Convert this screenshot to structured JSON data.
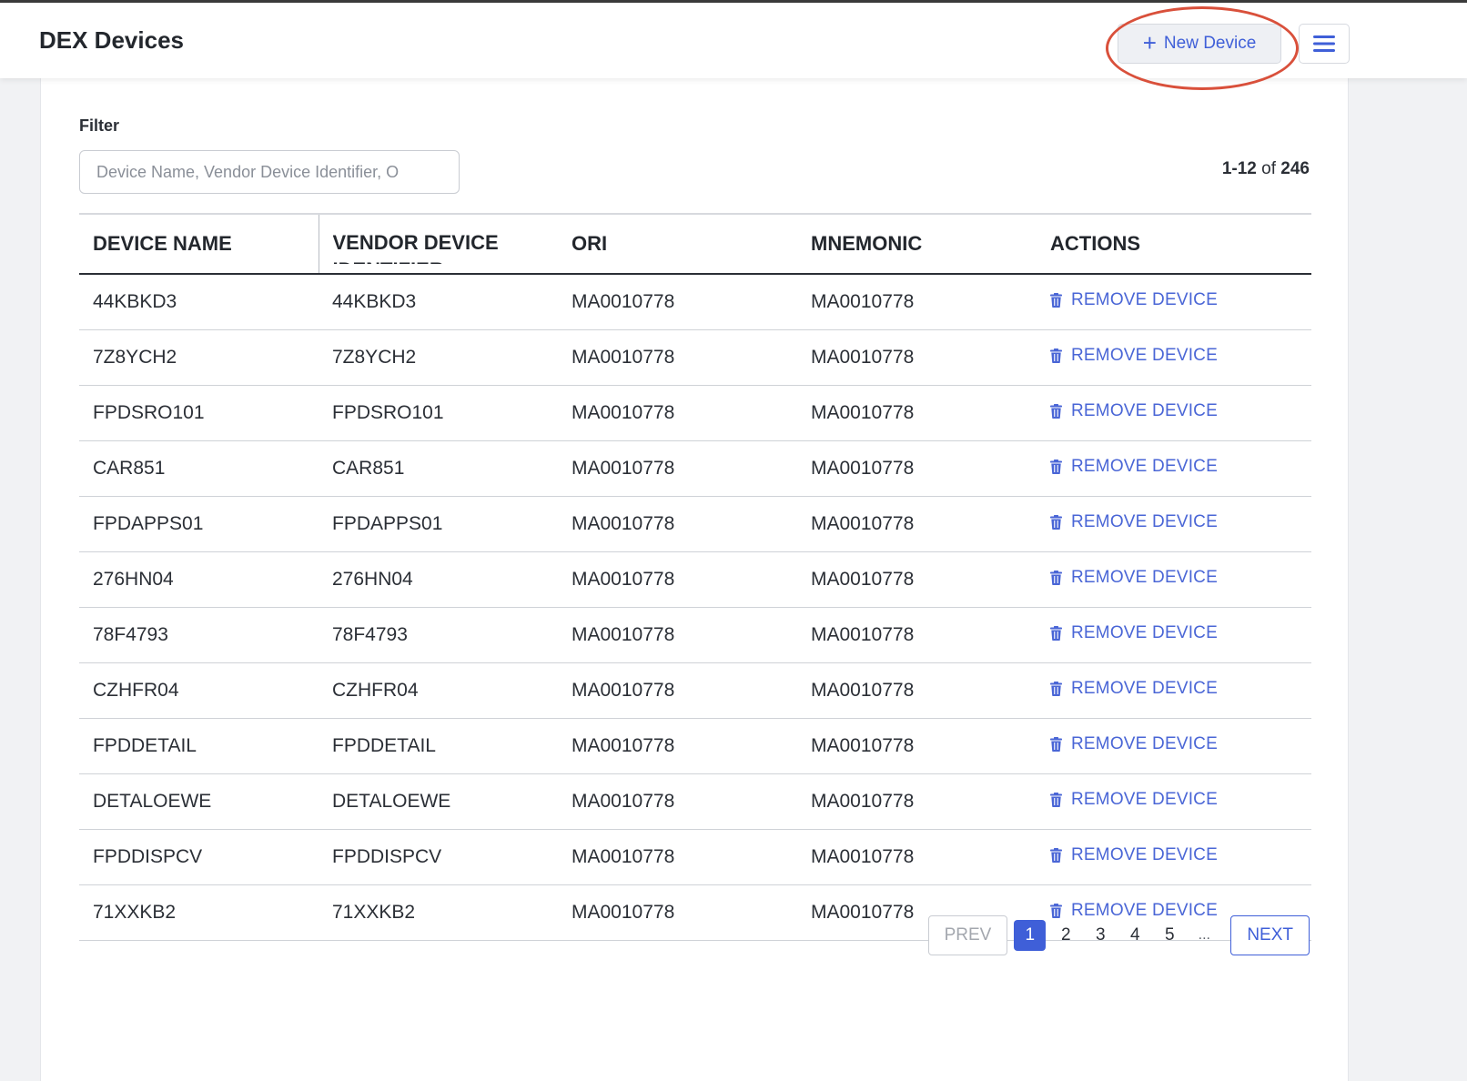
{
  "header": {
    "title": "DEX Devices",
    "new_device_label": "New Device",
    "plus_glyph": "+",
    "menu_icon": "hamburger-menu-icon"
  },
  "filter": {
    "label": "Filter",
    "placeholder": "Device Name, Vendor Device Identifier, O",
    "value": ""
  },
  "range": {
    "shown": "1-12",
    "of_label": "of",
    "total": "246"
  },
  "table": {
    "columns": [
      "DEVICE NAME",
      "VENDOR DEVICE IDENTIFIER",
      "ORI",
      "MNEMONIC",
      "ACTIONS"
    ],
    "action_label": "REMOVE DEVICE",
    "action_icon": "trash-icon",
    "rows": [
      [
        "44KBKD3",
        "44KBKD3",
        "MA0010778",
        "MA0010778"
      ],
      [
        "7Z8YCH2",
        "7Z8YCH2",
        "MA0010778",
        "MA0010778"
      ],
      [
        "FPDSRO101",
        "FPDSRO101",
        "MA0010778",
        "MA0010778"
      ],
      [
        "CAR851",
        "CAR851",
        "MA0010778",
        "MA0010778"
      ],
      [
        "FPDAPPS01",
        "FPDAPPS01",
        "MA0010778",
        "MA0010778"
      ],
      [
        "276HN04",
        "276HN04",
        "MA0010778",
        "MA0010778"
      ],
      [
        "78F4793",
        "78F4793",
        "MA0010778",
        "MA0010778"
      ],
      [
        "CZHFR04",
        "CZHFR04",
        "MA0010778",
        "MA0010778"
      ],
      [
        "FPDDETAIL",
        "FPDDETAIL",
        "MA0010778",
        "MA0010778"
      ],
      [
        "DETALOEWE",
        "DETALOEWE",
        "MA0010778",
        "MA0010778"
      ],
      [
        "FPDDISPCV",
        "FPDDISPCV",
        "MA0010778",
        "MA0010778"
      ],
      [
        "71XXKB2",
        "71XXKB2",
        "MA0010778",
        "MA0010778"
      ]
    ]
  },
  "pagination": {
    "prev_label": "PREV",
    "next_label": "NEXT",
    "pages": [
      "1",
      "2",
      "3",
      "4",
      "5"
    ],
    "current": "1",
    "ellipsis": "..."
  },
  "colors": {
    "accent": "#3f5fd8",
    "link": "#4a66d6",
    "annotation": "#d9503b"
  }
}
